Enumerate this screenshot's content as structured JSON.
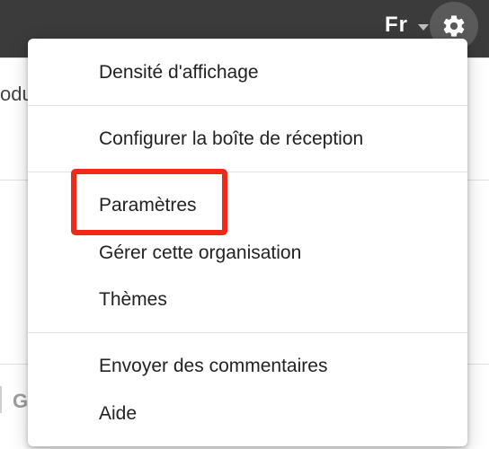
{
  "header": {
    "language_label": "Fr",
    "settings_icon": "gear-icon",
    "caret_icon": "caret-down-icon"
  },
  "background": {
    "partial_text_1": "odu",
    "partial_text_2": "G"
  },
  "menu": {
    "items": [
      {
        "label": "Densité d'affichage"
      },
      {
        "label": "Configurer la boîte de réception"
      },
      {
        "label": "Paramètres"
      },
      {
        "label": "Gérer cette organisation"
      },
      {
        "label": "Thèmes"
      },
      {
        "label": "Envoyer des commentaires"
      },
      {
        "label": "Aide"
      }
    ]
  },
  "colors": {
    "topbar": "#3b3b3b",
    "highlight": "#f0291a",
    "text": "#222222"
  }
}
